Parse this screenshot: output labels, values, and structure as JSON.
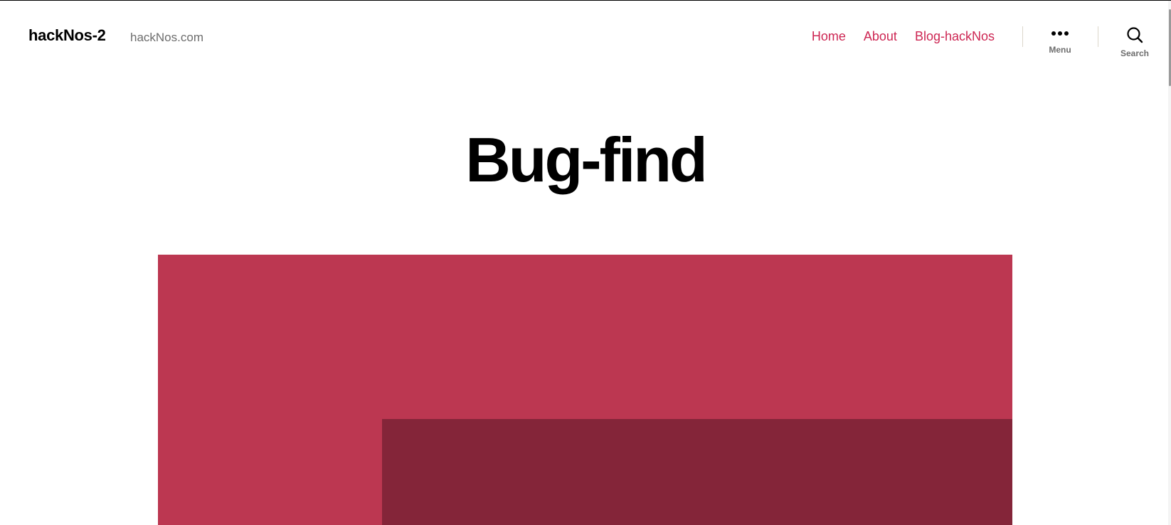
{
  "header": {
    "site_title": "hackNos-2",
    "site_description": "hackNos.com",
    "nav": [
      "Home",
      "About",
      "Blog-hackNos"
    ],
    "menu_label": "Menu",
    "search_label": "Search"
  },
  "post": {
    "title": "Bug-find"
  },
  "colors": {
    "accent": "#cd2653",
    "featured_primary": "#bc3751",
    "featured_secondary": "#842539"
  }
}
